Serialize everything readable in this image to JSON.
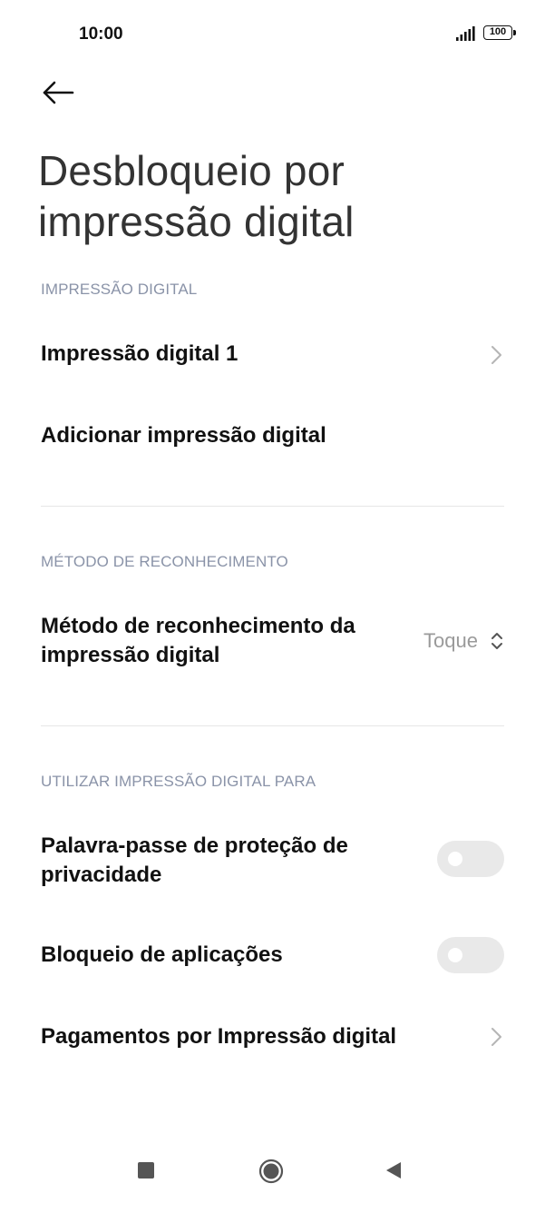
{
  "status_bar": {
    "time": "10:00",
    "battery": "100",
    "icons": [
      "signal-icon",
      "battery-icon"
    ]
  },
  "header": {
    "back_icon": "back-arrow-icon",
    "title": "Desbloqueio por impressão digital"
  },
  "sections": {
    "fingerprint": {
      "header": "IMPRESSÃO DIGITAL",
      "items": [
        {
          "label": "Impressão digital 1",
          "icon": "chevron-right-icon"
        },
        {
          "label": "Adicionar impressão digital"
        }
      ]
    },
    "recognition": {
      "header": "MÉTODO DE RECONHECIMENTO",
      "item": {
        "label_line1": "Método de reconhecimento da",
        "label_line2": "impressão digital",
        "value": "Toque",
        "icon": "up-down-chevron-icon"
      }
    },
    "use_for": {
      "header": "UTILIZAR IMPRESSÃO DIGITAL PARA",
      "items": [
        {
          "label_line1": "Palavra-passe de proteção de",
          "label_line2": "privacidade",
          "toggle_on": false
        },
        {
          "label": "Bloqueio de aplicações",
          "toggle_on": false
        },
        {
          "label": "Pagamentos por Impressão digital",
          "icon": "chevron-right-icon"
        }
      ]
    }
  },
  "colors": {
    "section_header": "#8a93a8",
    "title": "#333333",
    "toggle_off": "#e9e9e9"
  },
  "nav_bar": {
    "icons": [
      "recents-square-icon",
      "home-circle-icon",
      "back-triangle-icon"
    ]
  }
}
